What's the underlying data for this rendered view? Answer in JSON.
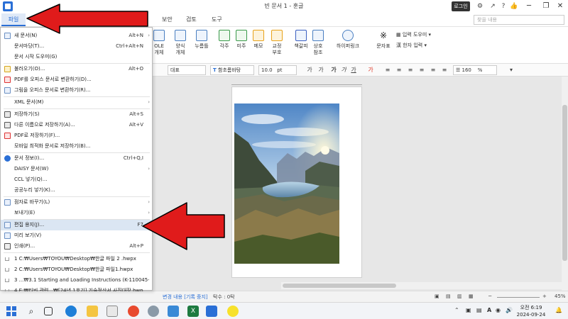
{
  "window": {
    "title": "빈 문서 1 - 훈글",
    "login_label": "로그인",
    "search_placeholder": "찾을 내용"
  },
  "menubar": {
    "file": "파일",
    "items": [
      "보안",
      "검토",
      "도구"
    ]
  },
  "ribbon": {
    "items": [
      {
        "label": "OLE",
        "label2": "개체"
      },
      {
        "label": "양식",
        "label2": "개체"
      },
      {
        "label": "누름틀",
        "label2": ""
      },
      {
        "label": "각주",
        "label2": ""
      },
      {
        "label": "미주",
        "label2": ""
      },
      {
        "label": "메모",
        "label2": ""
      },
      {
        "label": "교정",
        "label2": "부호"
      },
      {
        "label": "책갈피",
        "label2": ""
      },
      {
        "label": "상호",
        "label2": "참조"
      },
      {
        "label": "하이퍼링크",
        "label2": ""
      },
      {
        "label": "문자표",
        "label2": ""
      }
    ],
    "input_helper": "입력 도우미",
    "hanja_input": "한자 입력"
  },
  "formatbar": {
    "style": "대표",
    "font": "함초롬바탕",
    "size": "10.0",
    "size_unit": "pt",
    "line_spacing": "160",
    "line_unit": "%"
  },
  "file_menu": {
    "items": [
      {
        "label": "새 문서(N)",
        "shortcut": "Alt+N",
        "arrow": "›"
      },
      {
        "label": "문서마당(T)...",
        "shortcut": "Ctrl+Alt+N",
        "arrow": ""
      },
      {
        "label": "문서 시작 도우미(G)",
        "shortcut": "",
        "arrow": ""
      },
      {
        "label": "불러오기(O)...",
        "shortcut": "Alt+O",
        "arrow": ""
      },
      {
        "label": "PDF를 오피스 문서로 변환하기(D)...",
        "shortcut": "",
        "arrow": ""
      },
      {
        "label": "그림을 오피스 문서로 변환하기(R)...",
        "shortcut": "",
        "arrow": ""
      },
      {
        "label": "XML 문서(M)",
        "shortcut": "",
        "arrow": "›"
      },
      {
        "label": "저장하기(S)",
        "shortcut": "Alt+S",
        "arrow": ""
      },
      {
        "label": "다른 이름으로 저장하기(A)...",
        "shortcut": "Alt+V",
        "arrow": ""
      },
      {
        "label": "PDF로 저장하기(F)...",
        "shortcut": "",
        "arrow": ""
      },
      {
        "label": "모바일 최적화 문서로 저장하기(B)...",
        "shortcut": "",
        "arrow": ""
      },
      {
        "label": "문서 정보(I)...",
        "shortcut": "Ctrl+Q,I",
        "arrow": ""
      },
      {
        "label": "DAISY 문서(W)",
        "shortcut": "",
        "arrow": "›"
      },
      {
        "label": "CCL 넣기(Q)...",
        "shortcut": "",
        "arrow": ""
      },
      {
        "label": "공공누리 넣기(K)...",
        "shortcut": "",
        "arrow": ""
      },
      {
        "label": "점자로 바꾸기(L)",
        "shortcut": "",
        "arrow": "›"
      },
      {
        "label": "보내기(E)",
        "shortcut": "",
        "arrow": "›"
      },
      {
        "label": "편집 용지(J)...",
        "shortcut": "F7",
        "arrow": ""
      },
      {
        "label": "미리 보기(V)",
        "shortcut": "",
        "arrow": ""
      },
      {
        "label": "인쇄(P)...",
        "shortcut": "Alt+P",
        "arrow": ""
      }
    ],
    "recent": [
      "1 C:₩Users₩TOYOU₩Desktop₩한글 파일 2 .hwpx",
      "2 C:₩Users₩TOYOU₩Desktop₩한글 파일1.hwpx",
      "3 ...₩3.1 Starting and Loading Instructions (K-110045-...",
      "4 E:₩티빈 관련...₩[24년 1호기] 기술정산서 사진대장.hwp"
    ]
  },
  "statusbar": {
    "change": "변경 내용 [기록 중지]",
    "insert": "탁수 : 0탁",
    "zoom": "45%"
  },
  "clock": {
    "time": "오전 6:19",
    "date": "2024-09-24"
  },
  "colors": {
    "accent": "#2a6fd6",
    "arrow": "#e01b1b"
  }
}
